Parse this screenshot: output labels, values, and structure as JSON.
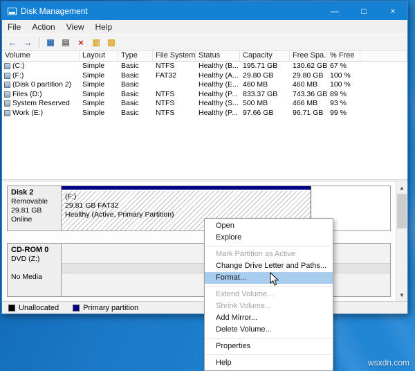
{
  "desktop": {
    "watermark": "wsxdn.com"
  },
  "win": {
    "title": "Disk Management",
    "controls": {
      "minimize": "—",
      "maximize": "□",
      "close": "×"
    },
    "menus": [
      "File",
      "Action",
      "View",
      "Help"
    ],
    "toolbar": [
      "←",
      "→",
      "▦",
      "▤",
      "×",
      "▥",
      "▧"
    ],
    "colors": {
      "titlebar": "#1581d5",
      "primary_partition": "#000082",
      "unallocated": "#000000",
      "menu_highlight": "#a9cdee"
    },
    "table": {
      "columns": [
        "Volume",
        "Layout",
        "Type",
        "File System",
        "Status",
        "Capacity",
        "Free Spa...",
        "% Free"
      ],
      "rows": [
        [
          "(C:)",
          "Simple",
          "Basic",
          "NTFS",
          "Healthy (B...",
          "195.71 GB",
          "130.62 GB",
          "67 %"
        ],
        [
          "(F:)",
          "Simple",
          "Basic",
          "FAT32",
          "Healthy (A...",
          "29.80 GB",
          "29.80 GB",
          "100 %"
        ],
        [
          "(Disk 0 partition 2)",
          "Simple",
          "Basic",
          "",
          "Healthy (E...",
          "460 MB",
          "460 MB",
          "100 %"
        ],
        [
          "Files (D:)",
          "Simple",
          "Basic",
          "NTFS",
          "Healthy (P...",
          "833.37 GB",
          "743.36 GB",
          "89 %"
        ],
        [
          "System Reserved",
          "Simple",
          "Basic",
          "NTFS",
          "Healthy (S...",
          "500 MB",
          "466 MB",
          "93 %"
        ],
        [
          "Work (E:)",
          "Simple",
          "Basic",
          "NTFS",
          "Healthy (P...",
          "97.66 GB",
          "96.71 GB",
          "99 %"
        ]
      ]
    },
    "disk2": {
      "name": "Disk 2",
      "media": "Removable",
      "size": "29.81 GB",
      "status": "Online",
      "part_label": "(F:)",
      "part_detail": "29.81 GB FAT32",
      "part_health": "Healthy (Active, Primary Partition)"
    },
    "cdrom": {
      "name": "CD-ROM 0",
      "media": "DVD (Z:)",
      "status": "No Media"
    },
    "legend": [
      {
        "label": "Unallocated",
        "color": "#000000"
      },
      {
        "label": "Primary partition",
        "color": "#000082"
      }
    ]
  },
  "menu": {
    "items": [
      {
        "label": "Open"
      },
      {
        "label": "Explore"
      },
      {
        "label": "Mark Partition as Active",
        "disabled": true
      },
      {
        "label": "Change Drive Letter and Paths..."
      },
      {
        "label": "Format...",
        "highlighted": true
      },
      {
        "label": "Extend Volume...",
        "disabled": true
      },
      {
        "label": "Shrink Volume...",
        "disabled": true
      },
      {
        "label": "Add Mirror..."
      },
      {
        "label": "Delete Volume..."
      },
      {
        "label": "Properties"
      },
      {
        "label": "Help"
      }
    ]
  }
}
